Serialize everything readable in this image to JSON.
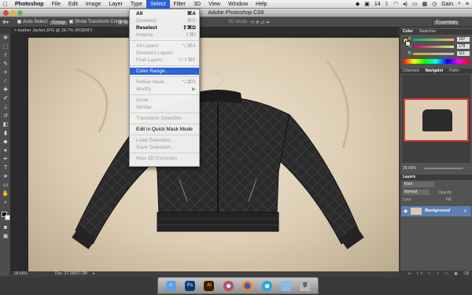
{
  "menubar": {
    "apple": "",
    "items": [
      "Photoshop",
      "File",
      "Edit",
      "Image",
      "Layer",
      "Type",
      "Select",
      "Filter",
      "3D",
      "View",
      "Window",
      "Help"
    ],
    "right": {
      "num": "14",
      "time": "Gain"
    }
  },
  "window": {
    "title": "Adobe Photoshop CS6"
  },
  "options_bar": {
    "auto_select": "Auto-Select:",
    "group": "Group",
    "show_transform": "Show Transform Controls",
    "mode_3d": "3D Mode:",
    "workspace": "Essentials"
  },
  "doc": {
    "tab": "leather Jacket.JPG @ 28.7% (RGB/8*)",
    "zoom": "28.66%",
    "doc_size": "Doc: 27.2M/27.2M"
  },
  "select_menu": {
    "items": [
      {
        "label": "All",
        "shortcut": "⌘A",
        "enabled": true,
        "bold": true
      },
      {
        "label": "Deselect",
        "shortcut": "⌘D",
        "enabled": false
      },
      {
        "label": "Reselect",
        "shortcut": "⇧⌘D",
        "enabled": true,
        "bold": true
      },
      {
        "label": "Inverse",
        "shortcut": "⇧⌘I",
        "enabled": false
      },
      {
        "sep": true
      },
      {
        "label": "All Layers",
        "shortcut": "⌥⌘A",
        "enabled": false
      },
      {
        "label": "Deselect Layers",
        "shortcut": "",
        "enabled": false
      },
      {
        "label": "Find Layers",
        "shortcut": "⌥⇧⌘F",
        "enabled": false
      },
      {
        "sep": true
      },
      {
        "label": "Color Range...",
        "shortcut": "",
        "enabled": true,
        "highlight": true
      },
      {
        "sep": true
      },
      {
        "label": "Refine Mask...",
        "shortcut": "⌥⌘R",
        "enabled": false
      },
      {
        "label": "Modify",
        "shortcut": "▶",
        "enabled": false
      },
      {
        "sep": true
      },
      {
        "label": "Grow",
        "shortcut": "",
        "enabled": false
      },
      {
        "label": "Similar",
        "shortcut": "",
        "enabled": false
      },
      {
        "sep": true
      },
      {
        "label": "Transform Selection",
        "shortcut": "",
        "enabled": false
      },
      {
        "sep": true
      },
      {
        "label": "Edit in Quick Mask Mode",
        "shortcut": "",
        "enabled": true
      },
      {
        "sep": true
      },
      {
        "label": "Load Selection...",
        "shortcut": "",
        "enabled": false
      },
      {
        "label": "Save Selection...",
        "shortcut": "",
        "enabled": false
      },
      {
        "sep": true
      },
      {
        "label": "New 3D Extrusion",
        "shortcut": "",
        "enabled": false
      }
    ]
  },
  "panels": {
    "color_tabs": [
      "Color",
      "Swatches"
    ],
    "rgb": [
      {
        "ch": "R",
        "val": "197"
      },
      {
        "ch": "G",
        "val": "179"
      },
      {
        "ch": "B",
        "val": "111"
      }
    ],
    "nav_tabs": [
      "Channels",
      "Navigator",
      "Paths"
    ],
    "nav_zoom": "28.66%",
    "layers_title": "Layers",
    "kind": "Kind",
    "blend": "Normal",
    "opacity_label": "Opacity:",
    "lock_label": "Lock:",
    "fill_label": "Fill:",
    "layer_name": "Background"
  },
  "dock": {
    "icons": [
      "finder-icon",
      "ps-icon",
      "ai-icon",
      "chrome-icon",
      "firefox-icon",
      "itunes-icon",
      "folder-icon",
      "trash-icon"
    ]
  },
  "colors": {
    "menu_highlight": "#2a63d8",
    "ps_blue": "#0a3a74",
    "ai_orange": "#7a3b00"
  }
}
